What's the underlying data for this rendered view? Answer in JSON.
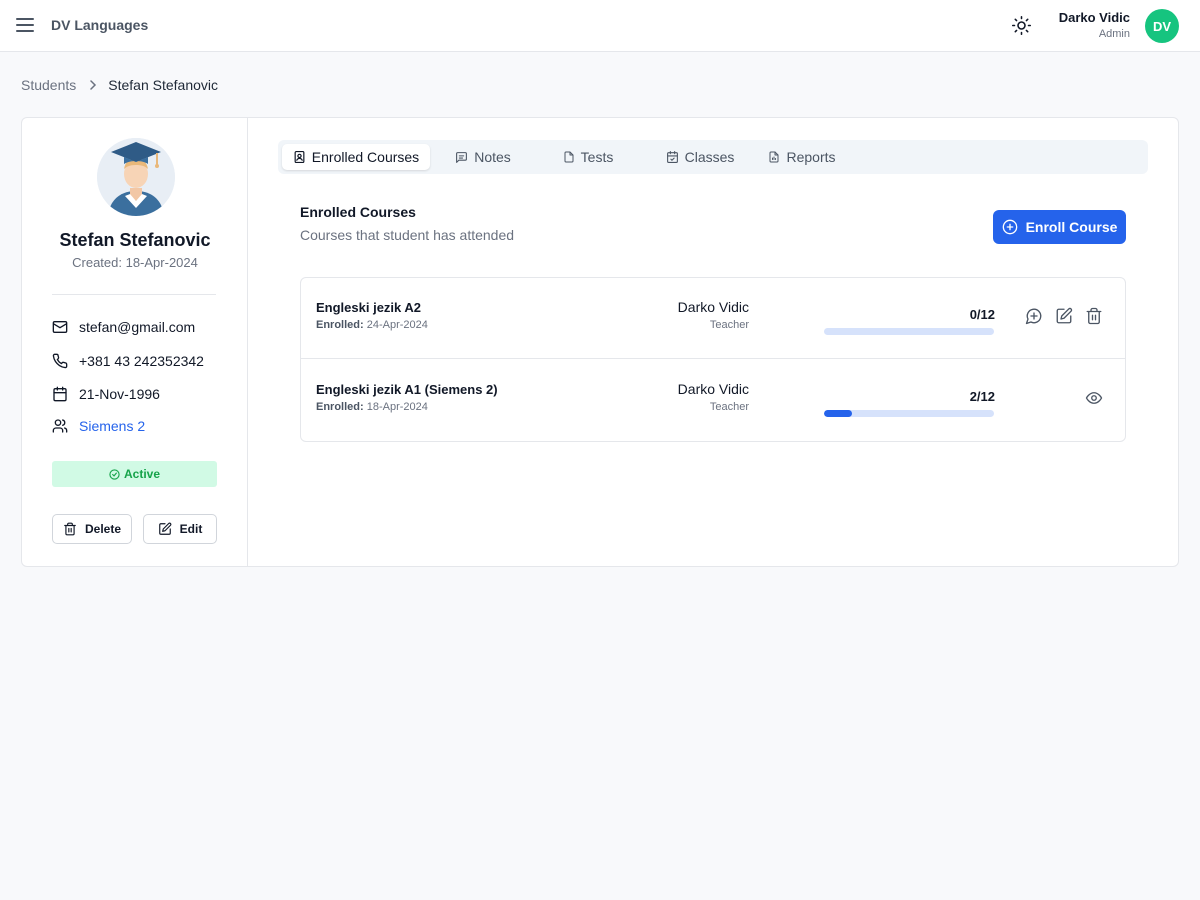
{
  "app": {
    "title": "DV Languages"
  },
  "user": {
    "name": "Darko Vidic",
    "role": "Admin",
    "initials": "DV"
  },
  "breadcrumb": {
    "parent": "Students",
    "current": "Stefan Stefanovic"
  },
  "student": {
    "name": "Stefan Stefanovic",
    "created": "Created: 18-Apr-2024",
    "email": "stefan@gmail.com",
    "phone": "+381 43 242352342",
    "birthdate": "21-Nov-1996",
    "group": "Siemens 2",
    "status": "Active",
    "delete_label": "Delete",
    "edit_label": "Edit"
  },
  "tabs": [
    {
      "label": "Enrolled Courses",
      "icon": "contact-icon",
      "active": true
    },
    {
      "label": "Notes",
      "icon": "message-icon",
      "active": false
    },
    {
      "label": "Tests",
      "icon": "file-icon",
      "active": false
    },
    {
      "label": "Classes",
      "icon": "calendar-check-icon",
      "active": false
    },
    {
      "label": "Reports",
      "icon": "file-chart-icon",
      "active": false
    }
  ],
  "section": {
    "title": "Enrolled Courses",
    "subtitle": "Courses that student has attended",
    "enroll_label": "Enroll Course"
  },
  "courses": [
    {
      "name": "Engleski jezik A2",
      "enrolled_label": "Enrolled:",
      "enrolled_date": "24-Apr-2024",
      "teacher": "Darko Vidic",
      "teacher_role": "Teacher",
      "progress_text": "0/12",
      "progress": 0
    },
    {
      "name": "Engleski jezik A1 (Siemens 2)",
      "enrolled_label": "Enrolled:",
      "enrolled_date": "18-Apr-2024",
      "teacher": "Darko Vidic",
      "teacher_role": "Teacher",
      "progress_text": "2/12",
      "progress": 0.1667
    }
  ],
  "colors": {
    "accent": "#2563eb",
    "avatar": "#16c47f",
    "status_bg": "#d1fae5",
    "status_text": "#16a34a"
  }
}
